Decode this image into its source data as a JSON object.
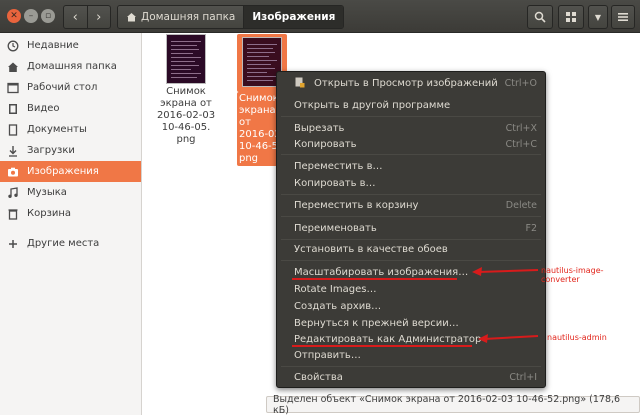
{
  "window": {
    "breadcrumbs": [
      "Домашняя папка",
      "Изображения"
    ]
  },
  "sidebar": {
    "items": [
      {
        "label": "Недавние",
        "icon": "clock-icon"
      },
      {
        "label": "Домашняя папка",
        "icon": "home-icon"
      },
      {
        "label": "Рабочий стол",
        "icon": "desktop-icon"
      },
      {
        "label": "Видео",
        "icon": "video-icon"
      },
      {
        "label": "Документы",
        "icon": "document-icon"
      },
      {
        "label": "Загрузки",
        "icon": "download-icon"
      },
      {
        "label": "Изображения",
        "icon": "camera-icon"
      },
      {
        "label": "Музыка",
        "icon": "music-icon"
      },
      {
        "label": "Корзина",
        "icon": "trash-icon"
      },
      {
        "label": "Другие места",
        "icon": "plus-icon"
      }
    ],
    "active_index": 6
  },
  "files": [
    {
      "lines": [
        "Снимок",
        "экрана от",
        "2016-02-03",
        "10-46-05.",
        "png"
      ]
    },
    {
      "lines": [
        "Снимок",
        "экрана от",
        "2016-02-",
        "10-46-5",
        "png"
      ]
    }
  ],
  "context_menu": {
    "items": [
      {
        "label": "Открыть в Просмотр изображений",
        "accel": "Ctrl+O"
      },
      {
        "label": "Открыть в другой программе",
        "accel": ""
      },
      {
        "label": "Вырезать",
        "accel": "Ctrl+X"
      },
      {
        "label": "Копировать",
        "accel": "Ctrl+C"
      },
      {
        "label": "Переместить в…",
        "accel": ""
      },
      {
        "label": "Копировать в…",
        "accel": ""
      },
      {
        "label": "Переместить в корзину",
        "accel": "Delete"
      },
      {
        "label": "Переименовать",
        "accel": "F2"
      },
      {
        "label": "Установить в качестве обоев",
        "accel": ""
      },
      {
        "label": "Масштабировать изображения…",
        "accel": ""
      },
      {
        "label": "Rotate Images…",
        "accel": ""
      },
      {
        "label": "Создать архив…",
        "accel": ""
      },
      {
        "label": "Вернуться к прежней версии…",
        "accel": ""
      },
      {
        "label": "Редактировать как Администратор",
        "accel": ""
      },
      {
        "label": "Отправить…",
        "accel": ""
      },
      {
        "label": "Свойства",
        "accel": "Ctrl+I"
      }
    ]
  },
  "annotations": {
    "converter": "nautilus-image-converter",
    "admin": "nautilus-admin"
  },
  "status_text": "Выделен объект «Снимок экрана от 2016-02-03 10-46-52.png» (178,6 кБ)",
  "colors": {
    "accent": "#f07746",
    "annotation": "#e2261c"
  }
}
